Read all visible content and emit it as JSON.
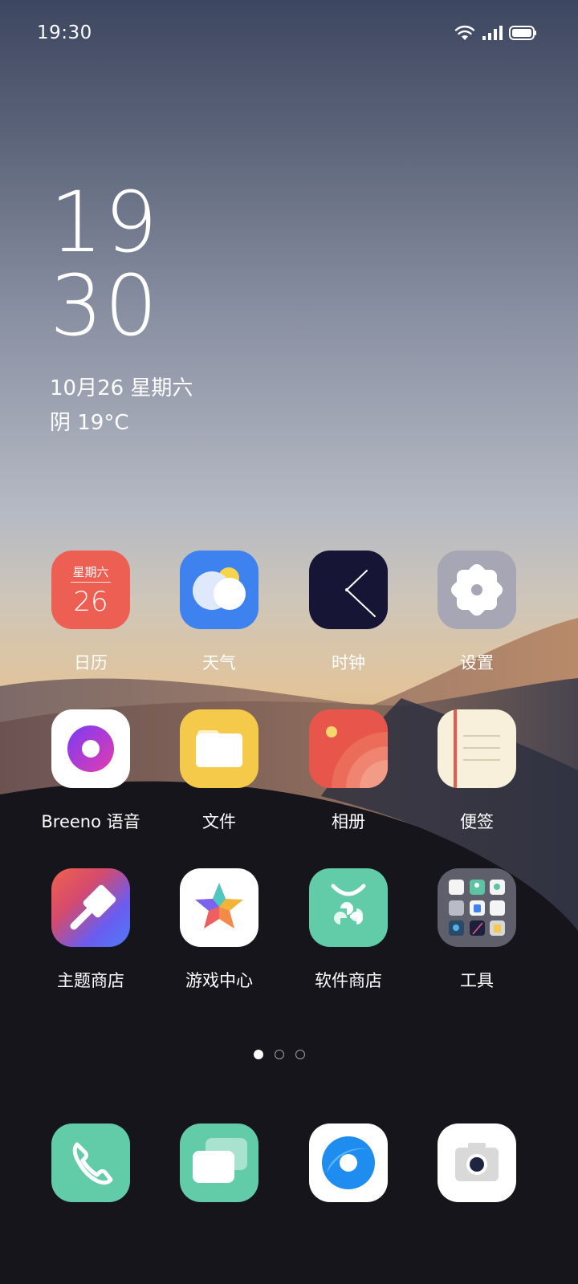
{
  "status": {
    "time": "19:30"
  },
  "clock": {
    "hour": "19",
    "minute": "30",
    "date": "10月26 星期六",
    "weather": "阴 19°C"
  },
  "calendar_icon": {
    "weekday": "星期六",
    "day": "26"
  },
  "apps": [
    {
      "label": "日历",
      "icon": "calendar-icon"
    },
    {
      "label": "天气",
      "icon": "weather-icon"
    },
    {
      "label": "时钟",
      "icon": "clock-icon"
    },
    {
      "label": "设置",
      "icon": "settings-icon"
    },
    {
      "label": "Breeno 语音",
      "icon": "breeno-icon"
    },
    {
      "label": "文件",
      "icon": "folder-icon"
    },
    {
      "label": "相册",
      "icon": "gallery-icon"
    },
    {
      "label": "便签",
      "icon": "notes-icon"
    },
    {
      "label": "主题商店",
      "icon": "theme-store-icon"
    },
    {
      "label": "游戏中心",
      "icon": "game-center-icon"
    },
    {
      "label": "软件商店",
      "icon": "app-store-icon"
    },
    {
      "label": "工具",
      "icon": "tools-folder-icon"
    }
  ],
  "page_indicator": {
    "pages": 3,
    "current": 1
  },
  "dock": [
    {
      "icon": "phone-icon"
    },
    {
      "icon": "messages-icon"
    },
    {
      "icon": "browser-icon"
    },
    {
      "icon": "camera-icon"
    }
  ],
  "colors": {
    "calendar": "#ec5f52",
    "weather": "#3e82f0",
    "clock": "#161536",
    "settings": "#a6a6b4",
    "files": "#f5c94a",
    "gallery": "#e8564b",
    "notes": "#f8f0da",
    "appstore": "#62cba8",
    "phone": "#62cba8"
  }
}
